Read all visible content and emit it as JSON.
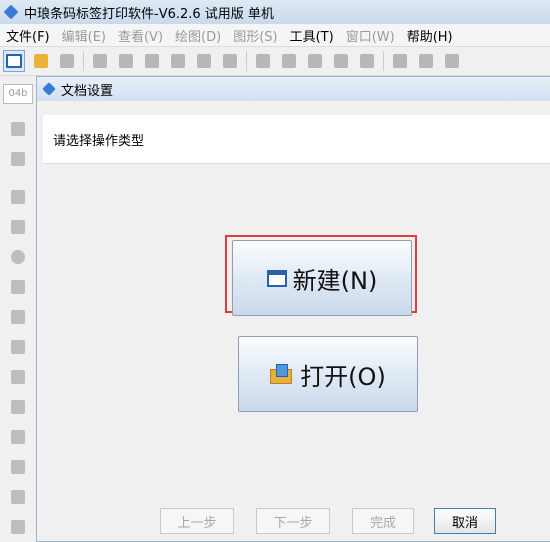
{
  "app": {
    "title": "中琅条码标签打印软件-V6.2.6 试用版 单机"
  },
  "menu": [
    {
      "label": "文件(F)",
      "enabled": true
    },
    {
      "label": "编辑(E)",
      "enabled": false
    },
    {
      "label": "查看(V)",
      "enabled": false
    },
    {
      "label": "绘图(D)",
      "enabled": false
    },
    {
      "label": "图形(S)",
      "enabled": false
    },
    {
      "label": "工具(T)",
      "enabled": true
    },
    {
      "label": "窗口(W)",
      "enabled": false
    },
    {
      "label": "帮助(H)",
      "enabled": true
    }
  ],
  "toolbar": {
    "icons": [
      "new-doc-icon",
      "open-folder-icon",
      "save-icon",
      "settings-icon",
      "print-icon",
      "print-preview-icon",
      "database-icon",
      "sheet-icon",
      "grid-icon",
      "cut-icon",
      "copy-icon",
      "paste-icon",
      "undo-icon",
      "redo-icon",
      "zoom-in-icon",
      "zoom-out-icon",
      "zoom-fit-icon"
    ]
  },
  "lefttool": {
    "zoom": "04b",
    "icons": [
      "pointer-icon",
      "pan-icon",
      "line-icon",
      "rectangle-icon",
      "ellipse-icon",
      "image-icon",
      "picture-icon",
      "text-icon",
      "multiline-text-icon",
      "barcode-icon",
      "shape-icon",
      "table-icon",
      "curve-icon",
      "arc-icon"
    ]
  },
  "dialog": {
    "title": "文档设置",
    "prompt": "请选择操作类型",
    "new_button": "新建(N)",
    "open_button": "打开(O)",
    "footer": {
      "prev": "上一步",
      "next": "下一步",
      "finish": "完成",
      "cancel": "取消"
    }
  }
}
